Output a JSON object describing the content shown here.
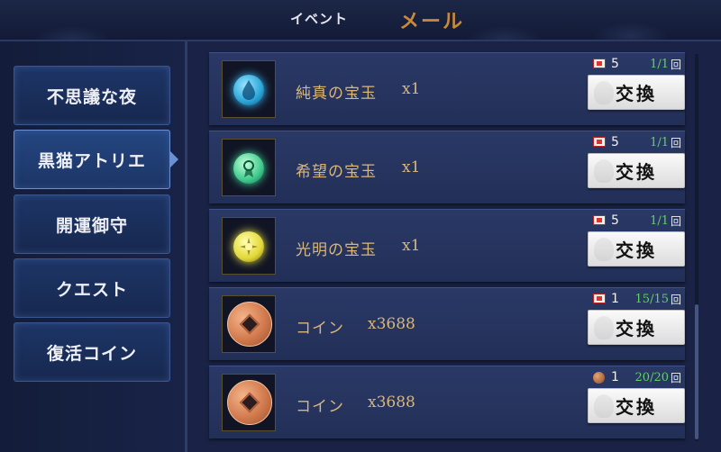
{
  "header": {
    "tabs": [
      {
        "label": "イベント",
        "active": false
      },
      {
        "label": "メール",
        "active": true
      }
    ]
  },
  "sidebar": {
    "items": [
      {
        "label": "不思議な夜",
        "active": false
      },
      {
        "label": "黒猫アトリエ",
        "active": true
      },
      {
        "label": "開運御守",
        "active": false
      },
      {
        "label": "クエスト",
        "active": false
      },
      {
        "label": "復活コイン",
        "active": false
      }
    ]
  },
  "exchange_list": [
    {
      "name": "純真の宝玉",
      "qty": "x1",
      "icon": "blue-drop-gem-icon",
      "cost_icon": "ticket-icon",
      "cost": "5",
      "limit": "1/1",
      "limit_unit": "回",
      "button": "交換"
    },
    {
      "name": "希望の宝玉",
      "qty": "x1",
      "icon": "green-ribbon-gem-icon",
      "cost_icon": "ticket-icon",
      "cost": "5",
      "limit": "1/1",
      "limit_unit": "回",
      "button": "交換"
    },
    {
      "name": "光明の宝玉",
      "qty": "x1",
      "icon": "yellow-sun-gem-icon",
      "cost_icon": "ticket-icon",
      "cost": "5",
      "limit": "1/1",
      "limit_unit": "回",
      "button": "交換"
    },
    {
      "name": "コイン",
      "qty": "x3688",
      "icon": "coin-icon",
      "cost_icon": "ticket-icon",
      "cost": "1",
      "limit": "15/15",
      "limit_unit": "回",
      "button": "交換"
    },
    {
      "name": "コイン",
      "qty": "x3688",
      "icon": "coin-icon",
      "cost_icon": "copper-coin-icon",
      "cost": "1",
      "limit": "20/20",
      "limit_unit": "回",
      "button": "交換"
    }
  ],
  "colors": {
    "accent_gold": "#c98a3a",
    "item_text": "#d9b77a",
    "limit_green": "#5fd35f"
  }
}
